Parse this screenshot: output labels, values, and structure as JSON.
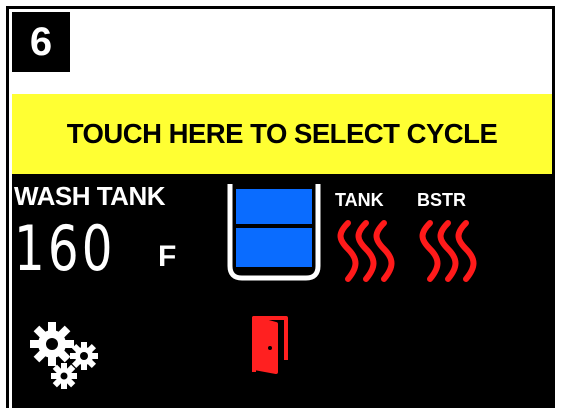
{
  "step": {
    "number": "6"
  },
  "screen": {
    "touch_bar_label": "TOUCH HERE TO SELECT CYCLE",
    "wash_tank_label": "WASH TANK",
    "temperature": {
      "value": "160",
      "unit": "F"
    },
    "heater_labels": {
      "tank": "TANK",
      "booster": "BSTR"
    },
    "icons": {
      "tank_level": "tank-level-icon",
      "tank_heater": "heat-waves-icon",
      "booster_heater": "heat-waves-icon",
      "settings": "gears-icon",
      "door": "door-open-icon"
    },
    "colors": {
      "touch_bar": "#ffff33",
      "screen_bg": "#000000",
      "tank_fill": "#0a6cff",
      "heater": "#ff1a1a",
      "door": "#ff2020"
    }
  }
}
